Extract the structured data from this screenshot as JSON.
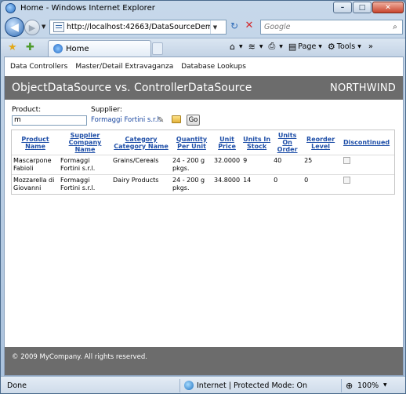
{
  "window": {
    "title": "Home - Windows Internet Explorer"
  },
  "address_bar": {
    "url": "http://localhost:42663/DataSourceDemo/Demo",
    "search_placeholder": "Google"
  },
  "tab": {
    "label": "Home"
  },
  "command_bar": {
    "page_label": "Page",
    "tools_label": "Tools"
  },
  "menu": {
    "items": [
      "Data Controllers",
      "Master/Detail Extravaganza",
      "Database Lookups"
    ]
  },
  "header": {
    "title": "ObjectDataSource vs. ControllerDataSource",
    "brand": "NORTHWIND"
  },
  "filters": {
    "product_label": "Product:",
    "product_value": "m",
    "supplier_label": "Supplier:",
    "supplier_value": "Formaggi Fortini s.r.l.",
    "go_label": "Go"
  },
  "grid": {
    "columns": [
      "Product Name",
      "Supplier Company Name",
      "Category Category Name",
      "Quantity Per Unit",
      "Unit Price",
      "Units In Stock",
      "Units On Order",
      "Reorder Level",
      "Discontinued"
    ],
    "rows": [
      {
        "product": "Mascarpone Fabioli",
        "supplier": "Formaggi Fortini s.r.l.",
        "category": "Grains/Cereals",
        "qty": "24 - 200 g pkgs.",
        "price": "32.0000",
        "stock": "9",
        "on_order": "40",
        "reorder": "25",
        "discontinued": false
      },
      {
        "product": "Mozzarella di Giovanni",
        "supplier": "Formaggi Fortini s.r.l.",
        "category": "Dairy Products",
        "qty": "24 - 200 g pkgs.",
        "price": "34.8000",
        "stock": "14",
        "on_order": "0",
        "reorder": "0",
        "discontinued": false
      }
    ]
  },
  "footer": {
    "text": "© 2009 MyCompany. All rights reserved."
  },
  "status_bar": {
    "status": "Done",
    "zone": "Internet | Protected Mode: On",
    "zoom": "100%"
  }
}
